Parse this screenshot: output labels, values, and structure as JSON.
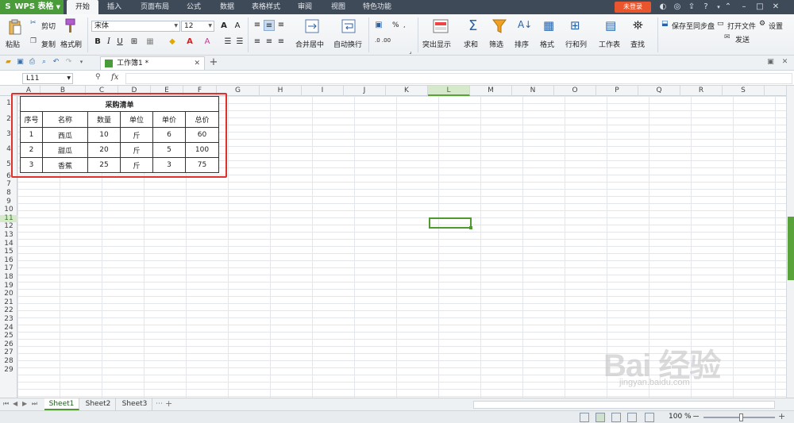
{
  "app": {
    "name": "WPS 表格",
    "logo": "S"
  },
  "menu": {
    "tabs": [
      "开始",
      "插入",
      "页面布局",
      "公式",
      "数据",
      "表格样式",
      "审阅",
      "视图",
      "特色功能"
    ],
    "active": "开始",
    "login": "未登录"
  },
  "ribbon": {
    "clipboard": {
      "paste": "粘贴",
      "cut": "剪切",
      "copy": "复制",
      "format_painter": "格式刷"
    },
    "font": {
      "name": "宋体",
      "size": "12",
      "bold": "B",
      "italic": "I",
      "underline": "U"
    },
    "merge": "合并居中",
    "wrap": "自动换行",
    "number": {
      "percent": "%"
    },
    "highlight": "突出显示",
    "sum": "求和",
    "filter": "筛选",
    "sort": "排序",
    "format": "格式",
    "rows_cols": "行和列",
    "worksheet": "工作表",
    "find": "查找",
    "save_sync": "保存至同步盘",
    "open_file": "打开文件",
    "settings": "设置",
    "send": "发送"
  },
  "document": {
    "tab_title": "工作簿1 *"
  },
  "formula_bar": {
    "name_box": "L11",
    "fx": "fx",
    "value": ""
  },
  "columns": [
    "A",
    "B",
    "C",
    "D",
    "E",
    "F",
    "G",
    "H",
    "I",
    "J",
    "K",
    "L",
    "M",
    "N",
    "O",
    "P",
    "Q",
    "R",
    "S"
  ],
  "selected_column": "L",
  "rows": [
    "1",
    "2",
    "3",
    "4",
    "5",
    "6",
    "7",
    "8",
    "9",
    "10",
    "11",
    "12",
    "13",
    "14",
    "15",
    "16",
    "17",
    "18",
    "19",
    "20",
    "21",
    "22",
    "23",
    "24",
    "25",
    "26",
    "27",
    "28",
    "29"
  ],
  "selected_row": "11",
  "purchase_table": {
    "title": "采购清单",
    "headers": [
      "序号",
      "名称",
      "数量",
      "单位",
      "单价",
      "总价"
    ],
    "rows": [
      [
        "1",
        "西瓜",
        "10",
        "斤",
        "6",
        "60"
      ],
      [
        "2",
        "甜瓜",
        "20",
        "斤",
        "5",
        "100"
      ],
      [
        "3",
        "香蕉",
        "25",
        "斤",
        "3",
        "75"
      ]
    ]
  },
  "sheets": [
    "Sheet1",
    "Sheet2",
    "Sheet3"
  ],
  "active_sheet": "Sheet1",
  "status": {
    "zoom": "100 %"
  },
  "watermark": {
    "brand": "Bai 经验",
    "url": "jingyan.baidu.com"
  },
  "colors": {
    "accent_green": "#4e9a2f",
    "title_bar": "#3f4a58",
    "login_red": "#e9562d",
    "highlight_red": "#e0322b"
  }
}
